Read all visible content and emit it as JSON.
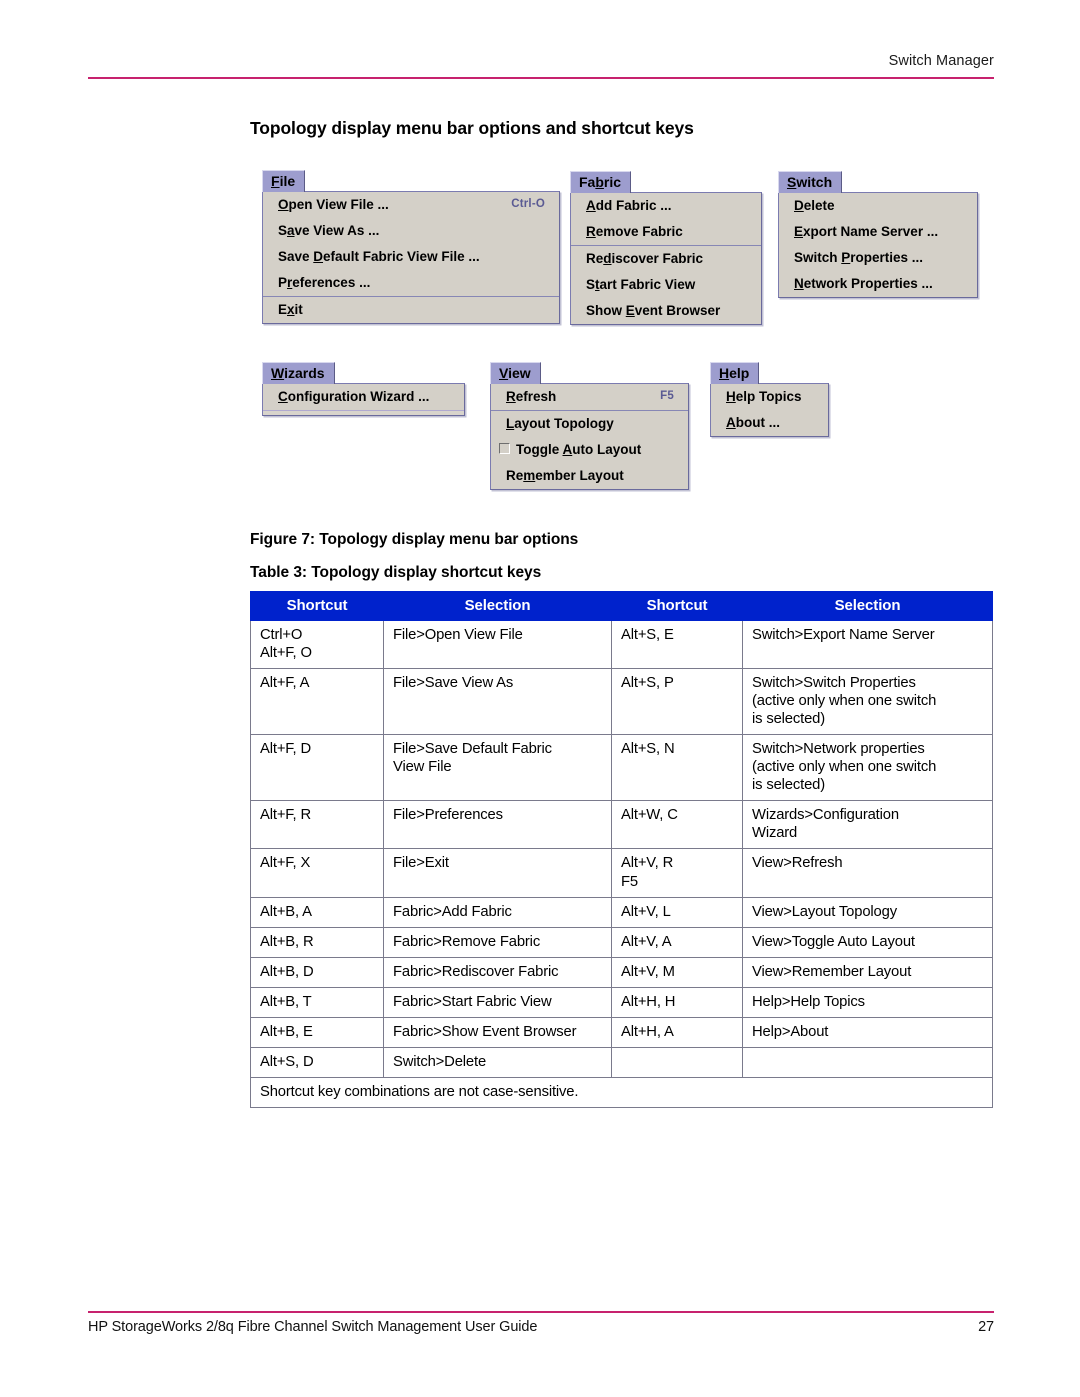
{
  "header": {
    "running_head": "Switch Manager"
  },
  "section": {
    "heading": "Topology display menu bar options and shortcut keys"
  },
  "menus": [
    {
      "id": "file",
      "title": "File",
      "title_mnemonic": "F",
      "groups": [
        {
          "items": [
            {
              "label": "Open View File ...",
              "mnemonic": "O",
              "accelerator": "Ctrl-O"
            },
            {
              "label": "Save View As ...",
              "mnemonic": "a",
              "accelerator": ""
            },
            {
              "label": "Save Default Fabric View File ...",
              "mnemonic": "D",
              "accelerator": ""
            },
            {
              "label": "Preferences ...",
              "mnemonic": "r",
              "accelerator": ""
            }
          ]
        },
        {
          "items": [
            {
              "label": "Exit",
              "mnemonic": "x",
              "accelerator": ""
            }
          ]
        }
      ]
    },
    {
      "id": "fabric",
      "title": "Fabric",
      "title_mnemonic": "b",
      "groups": [
        {
          "items": [
            {
              "label": "Add Fabric ...",
              "mnemonic": "A",
              "accelerator": ""
            },
            {
              "label": "Remove Fabric",
              "mnemonic": "R",
              "accelerator": ""
            }
          ]
        },
        {
          "items": [
            {
              "label": "Rediscover Fabric",
              "mnemonic": "d",
              "accelerator": ""
            },
            {
              "label": "Start Fabric View",
              "mnemonic": "t",
              "accelerator": ""
            },
            {
              "label": "Show Event Browser",
              "mnemonic": "E",
              "accelerator": ""
            }
          ]
        }
      ]
    },
    {
      "id": "switch",
      "title": "Switch",
      "title_mnemonic": "S",
      "groups": [
        {
          "items": [
            {
              "label": "Delete",
              "mnemonic": "D",
              "accelerator": ""
            },
            {
              "label": "Export Name Server ...",
              "mnemonic": "E",
              "accelerator": ""
            },
            {
              "label": "Switch Properties ...",
              "mnemonic": "P",
              "accelerator": ""
            },
            {
              "label": "Network Properties ...",
              "mnemonic": "N",
              "accelerator": ""
            }
          ]
        }
      ]
    },
    {
      "id": "wizards",
      "title": "Wizards",
      "title_mnemonic": "W",
      "groups": [
        {
          "items": [
            {
              "label": "Configuration Wizard ...",
              "mnemonic": "C",
              "accelerator": ""
            }
          ]
        }
      ]
    },
    {
      "id": "view",
      "title": "View",
      "title_mnemonic": "V",
      "groups": [
        {
          "items": [
            {
              "label": "Refresh",
              "mnemonic": "R",
              "accelerator": "F5"
            }
          ]
        },
        {
          "items": [
            {
              "label": "Layout Topology",
              "mnemonic": "L",
              "accelerator": ""
            },
            {
              "label": "Toggle Auto Layout",
              "mnemonic": "A",
              "accelerator": "",
              "checkbox": true,
              "checked": false
            },
            {
              "label": "Remember Layout",
              "mnemonic": "m",
              "accelerator": ""
            }
          ]
        }
      ]
    },
    {
      "id": "help",
      "title": "Help",
      "title_mnemonic": "H",
      "groups": [
        {
          "items": [
            {
              "label": "Help Topics",
              "mnemonic": "H",
              "accelerator": ""
            },
            {
              "label": "About ...",
              "mnemonic": "A",
              "accelerator": ""
            }
          ]
        }
      ]
    }
  ],
  "captions": {
    "figure": "Figure 7:  Topology display menu bar options",
    "table": "Table 3:  Topology display shortcut keys"
  },
  "table": {
    "headers": [
      "Shortcut",
      "Selection",
      "Shortcut",
      "Selection"
    ],
    "rows": [
      {
        "c1": [
          "Ctrl+O",
          "Alt+F, O"
        ],
        "c2": [
          "File>Open View File"
        ],
        "c3": [
          "Alt+S, E"
        ],
        "c4": [
          "Switch>Export Name Server"
        ]
      },
      {
        "c1": [
          "Alt+F, A"
        ],
        "c2": [
          "File>Save View As"
        ],
        "c3": [
          "Alt+S, P"
        ],
        "c4": [
          "Switch>Switch Properties",
          "(active only when one switch",
          "is selected)"
        ]
      },
      {
        "c1": [
          "Alt+F, D"
        ],
        "c2": [
          "File>Save Default Fabric",
          "View File"
        ],
        "c3": [
          "Alt+S, N"
        ],
        "c4": [
          "Switch>Network properties",
          "(active only when one switch",
          "is selected)"
        ]
      },
      {
        "c1": [
          "Alt+F, R"
        ],
        "c2": [
          "File>Preferences"
        ],
        "c3": [
          "Alt+W, C"
        ],
        "c4": [
          "Wizards>Configuration",
          "Wizard"
        ]
      },
      {
        "c1": [
          "Alt+F, X"
        ],
        "c2": [
          "File>Exit"
        ],
        "c3": [
          "Alt+V, R",
          "F5"
        ],
        "c4": [
          "View>Refresh"
        ]
      },
      {
        "c1": [
          "Alt+B, A"
        ],
        "c2": [
          "Fabric>Add Fabric"
        ],
        "c3": [
          "Alt+V, L"
        ],
        "c4": [
          "View>Layout Topology"
        ]
      },
      {
        "c1": [
          "Alt+B, R"
        ],
        "c2": [
          "Fabric>Remove Fabric"
        ],
        "c3": [
          "Alt+V, A"
        ],
        "c4": [
          "View>Toggle Auto Layout"
        ]
      },
      {
        "c1": [
          "Alt+B, D"
        ],
        "c2": [
          "Fabric>Rediscover Fabric"
        ],
        "c3": [
          "Alt+V, M"
        ],
        "c4": [
          "View>Remember Layout"
        ]
      },
      {
        "c1": [
          "Alt+B, T"
        ],
        "c2": [
          "Fabric>Start Fabric View"
        ],
        "c3": [
          "Alt+H, H"
        ],
        "c4": [
          "Help>Help Topics"
        ]
      },
      {
        "c1": [
          "Alt+B, E"
        ],
        "c2": [
          "Fabric>Show Event Browser"
        ],
        "c3": [
          "Alt+H, A"
        ],
        "c4": [
          "Help>About"
        ]
      },
      {
        "c1": [
          "Alt+S, D"
        ],
        "c2": [
          "Switch>Delete"
        ],
        "c3": [],
        "c4": []
      }
    ],
    "note": "Shortcut key combinations are not case-sensitive."
  },
  "footer": {
    "title": "HP StorageWorks 2/8q Fibre Channel Switch Management User Guide",
    "page_number": "27"
  },
  "colors": {
    "rule": "#c7226e",
    "table_header_bg": "#0022cc",
    "menu_title_bg": "#9d9dce",
    "menu_body_bg": "#d4d0c8",
    "accelerator_text": "#5a5a93"
  }
}
